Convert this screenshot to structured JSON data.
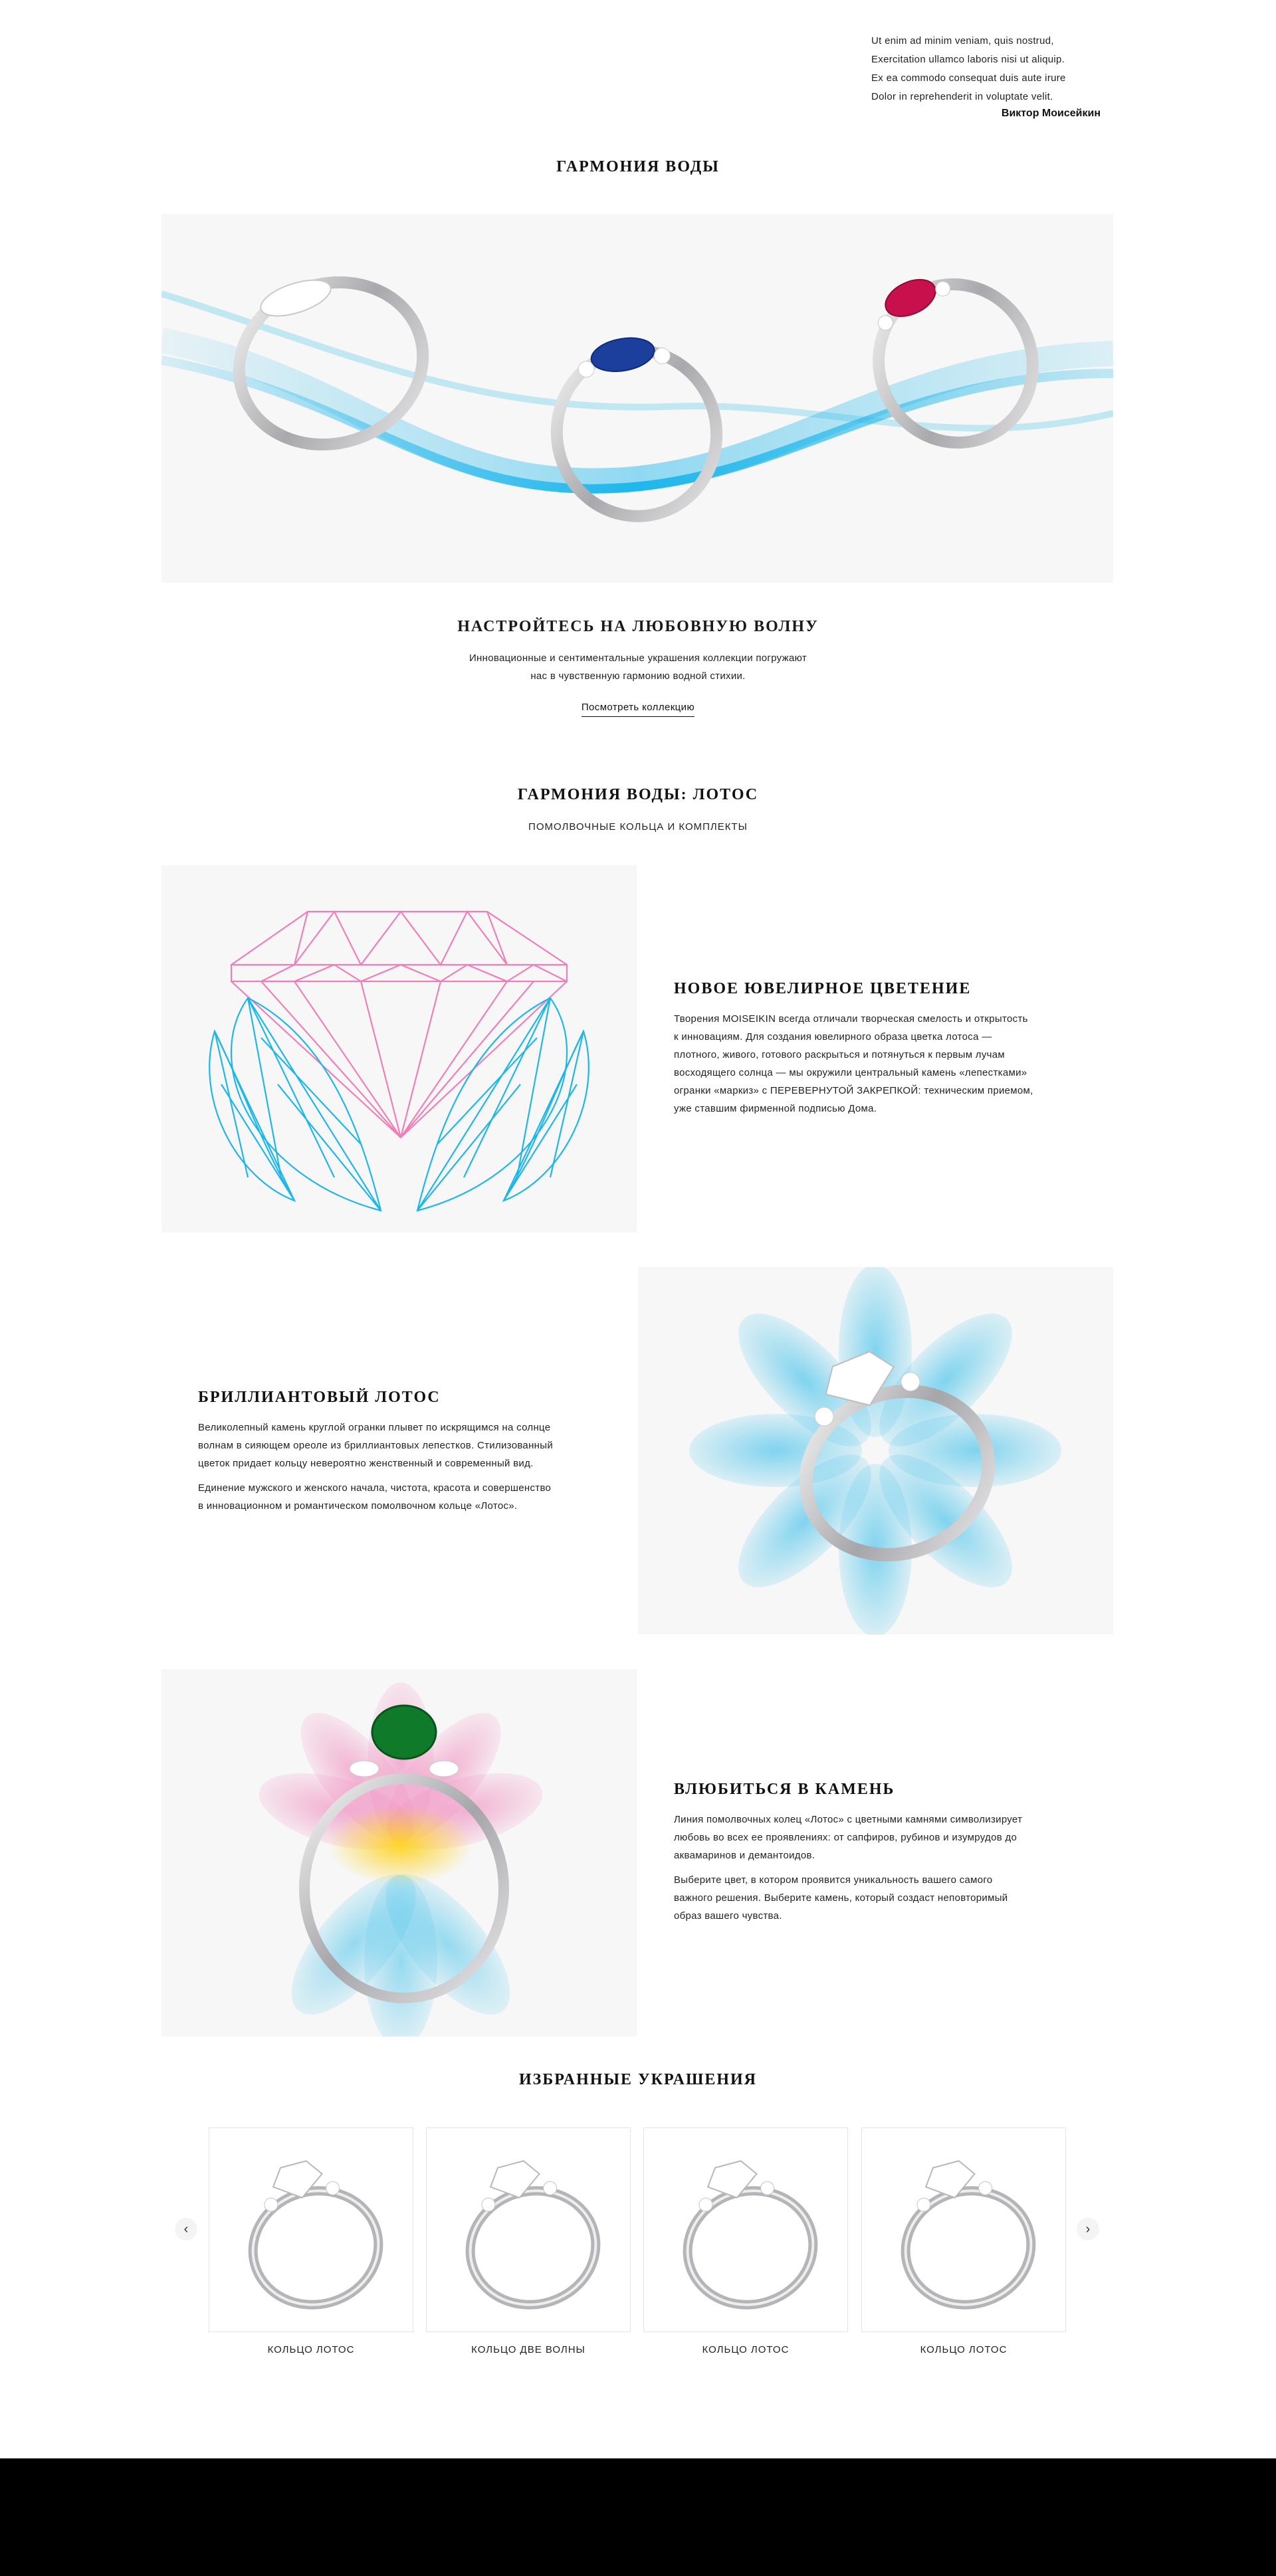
{
  "quote": {
    "lines": [
      "Ut enim ad minim veniam, quis nostrud,",
      "Exercitation ullamco laboris nisi ut aliquip.",
      "Ex ea commodo consequat duis aute irure",
      "Dolor in reprehenderit in voluptate velit."
    ],
    "author": "Виктор Моисейкин"
  },
  "harmony": {
    "title": "ГАРМОНИЯ ВОДЫ"
  },
  "intro": {
    "title": "НАСТРОЙТЕСЬ НА ЛЮБОВНУЮ ВОЛНУ",
    "text_line1": "Инновационные и сентиментальные украшения коллекции погружают",
    "text_line2": "нас в чувственную гармонию водной стихии.",
    "link": "Посмотреть коллекцию"
  },
  "lotus": {
    "title": "ГАРМОНИЯ ВОДЫ: ЛОТОС",
    "subtitle": "ПОМОЛВОЧНЫЕ КОЛЬЦА И КОМПЛЕКТЫ"
  },
  "blocks": [
    {
      "title": "НОВОЕ ЮВЕЛИРНОЕ ЦВЕТЕНИЕ",
      "lines": [
        "Творения MOISEIKIN всегда отличали творческая смелость и открытость",
        "к инновациям. Для создания ювелирного образа цветка лотоса —",
        "плотного, живого, готового раскрыться и потянуться к первым лучам",
        "восходящего солнца — мы окружили центральный камень «лепестками»",
        "огранки «маркиз» с ПЕРЕВЕРНУТОЙ ЗАКРЕПКОЙ: техническим приемом,",
        "уже ставшим фирменной подписью Дома."
      ]
    },
    {
      "title": "БРИЛЛИАНТОВЫЙ ЛОТОС",
      "para1": [
        "Великолепный камень круглой огранки плывет по искрящимся на солнце",
        "волнам в сияющем ореоле из бриллиантовых лепестков. Стилизованный",
        "цветок придает кольцу невероятно женственный и современный вид."
      ],
      "para2": [
        "Единение мужского и женского начала, чистота, красота и совершенство",
        "в инновационном и романтическом помолвочном кольце «Лотос»."
      ]
    },
    {
      "title": "ВЛЮБИТЬСЯ В КАМЕНЬ",
      "para1": [
        "Линия помолвочных колец «Лотос» с цветными камнями символизирует",
        "любовь во всех ее проявлениях: от сапфиров, рубинов и изумрудов до",
        "аквамаринов и демантоидов."
      ],
      "para2": [
        "Выберите цвет, в котором проявится уникальность вашего самого",
        "важного решения. Выберите камень, который создаст неповторимый",
        "образ вашего чувства."
      ]
    }
  ],
  "featured": {
    "title": "ИЗБРАННЫЕ УКРАШЕНИЯ",
    "items": [
      {
        "label": "КОЛЬЦО ЛОТОС"
      },
      {
        "label": "КОЛЬЦО ДВЕ ВОЛНЫ"
      },
      {
        "label": "КОЛЬЦО ЛОТОС"
      },
      {
        "label": "КОЛЬЦО ЛОТОС"
      }
    ],
    "prev_icon": "chevron-left-icon",
    "next_icon": "chevron-right-icon"
  },
  "colors": {
    "accent_blue": "#1fb6e8",
    "accent_pink": "#ef7fb8",
    "sapphire": "#1c3f9e",
    "ruby": "#c8104d",
    "emerald": "#0f7a2a",
    "footer": "#000000"
  }
}
